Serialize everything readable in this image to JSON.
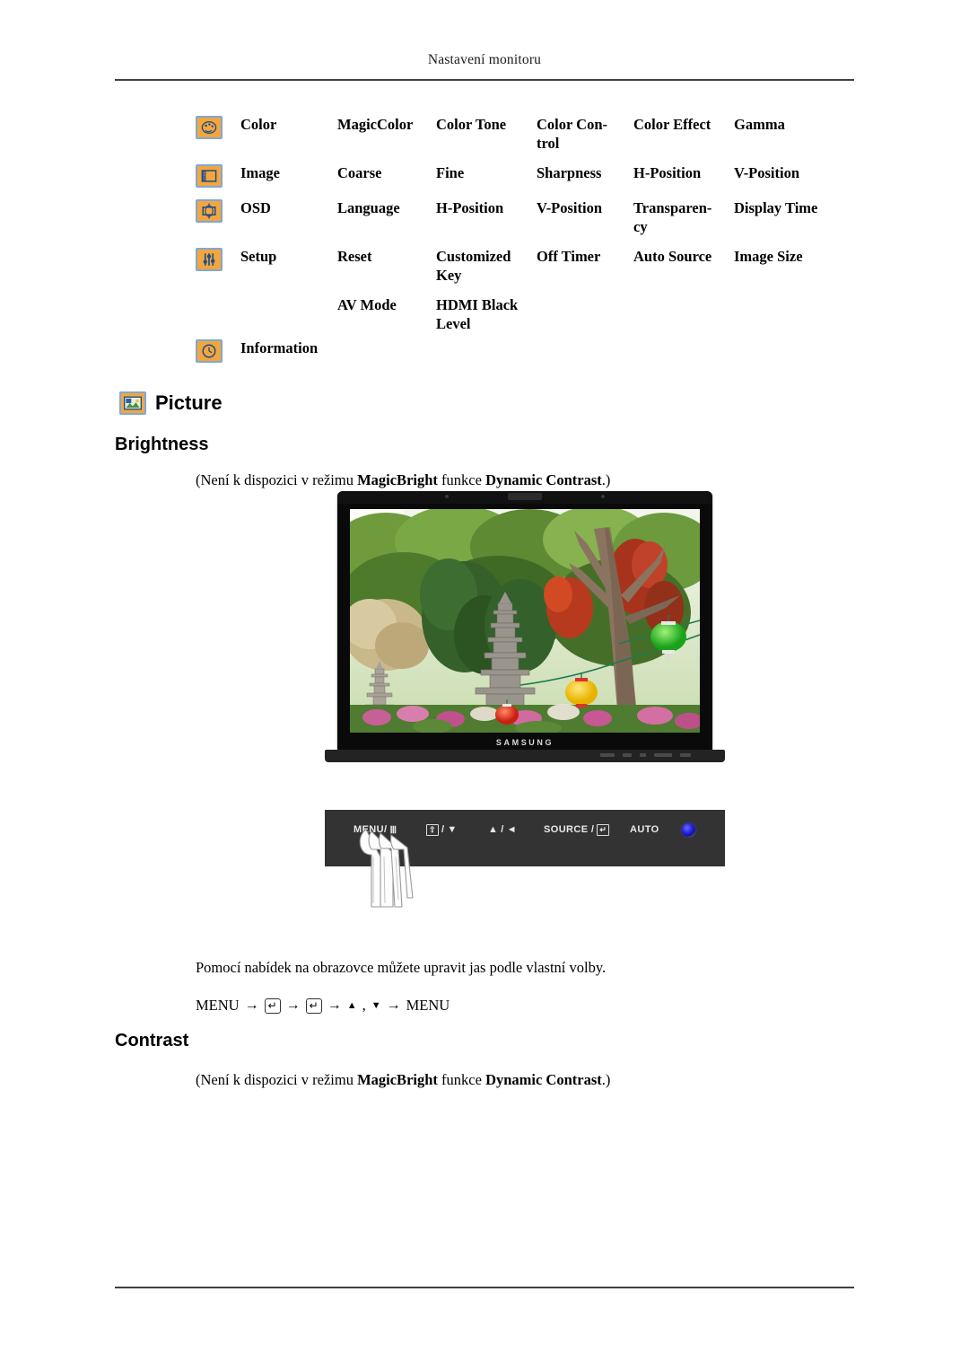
{
  "header": {
    "title": "Nastavení monitoru"
  },
  "menu_map": {
    "rows": [
      {
        "icon": "palette-icon",
        "label": "Color",
        "cells": [
          "MagicColor",
          "Color Tone",
          "Color Con-",
          "trol",
          "Color Effect",
          "Gamma"
        ],
        "c1": "MagicColor",
        "c2": "Color Tone",
        "c3": "Color Con-",
        "c3b": "trol",
        "c4": "Color Effect",
        "c5": "Gamma"
      },
      {
        "icon": "image-icon",
        "label": "Image",
        "c1": "Coarse",
        "c2": "Fine",
        "c3": "Sharpness",
        "c4": "H-Position",
        "c5": "V-Position"
      },
      {
        "icon": "osd-icon",
        "label": "OSD",
        "c1": "Language",
        "c2": "H-Position",
        "c3": "V-Position",
        "c4": "Transparen-",
        "c4b": "cy",
        "c5": "Display Time"
      },
      {
        "icon": "sliders-icon",
        "label": "Setup",
        "c1": "Reset",
        "c2": "Customized",
        "c2b": "Key",
        "c3": "Off Timer",
        "c4": "Auto Source",
        "c5": "Image Size"
      }
    ],
    "setup_subrow": {
      "c1": "AV Mode",
      "c2": "HDMI  Black",
      "c2b": "Level"
    },
    "information_row": {
      "icon": "clock-icon",
      "label": "Information"
    }
  },
  "picture_section": {
    "icon": "picture-icon",
    "title": "Picture"
  },
  "brightness": {
    "heading": "Brightness",
    "note_prefix": "(Není k dispozici v režimu ",
    "note_bold1": "MagicBright",
    "note_mid": " funkce ",
    "note_bold2": "Dynamic Contrast",
    "note_suffix": ".)",
    "usage": "Pomocí nabídek na obrazovce můžete upravit jas podle vlastní volby.",
    "path": {
      "menu_label": "MENU",
      "arrow": "→",
      "enter_key": "↵",
      "up_tri": "▲",
      "comma": ",",
      "down_tri": "▼",
      "menu_label_end": "MENU"
    }
  },
  "contrast": {
    "heading": "Contrast",
    "note_prefix": "(Není k dispozici v režimu ",
    "note_bold1": "MagicBright",
    "note_mid": " funkce ",
    "note_bold2": "Dynamic Contrast",
    "note_suffix": ".)"
  },
  "monitor": {
    "brand": "SAMSUNG",
    "controls": {
      "menu": "MENU/",
      "menu_glyph": "Ⅲ",
      "btn2_glyph": "⇧",
      "btn2_sep": "/",
      "btn2_tri": "▼",
      "btn3_tri": "▲",
      "btn3_sep": "/",
      "btn3_glyph": "◄",
      "source": "SOURCE /",
      "source_glyph": "↵",
      "auto": "AUTO",
      "power": "power-led"
    }
  },
  "colors": {
    "icon_fill": "#F4A63C",
    "icon_border": "#7FA8D4",
    "rule": "#404040",
    "power_led": "#2020dd"
  }
}
